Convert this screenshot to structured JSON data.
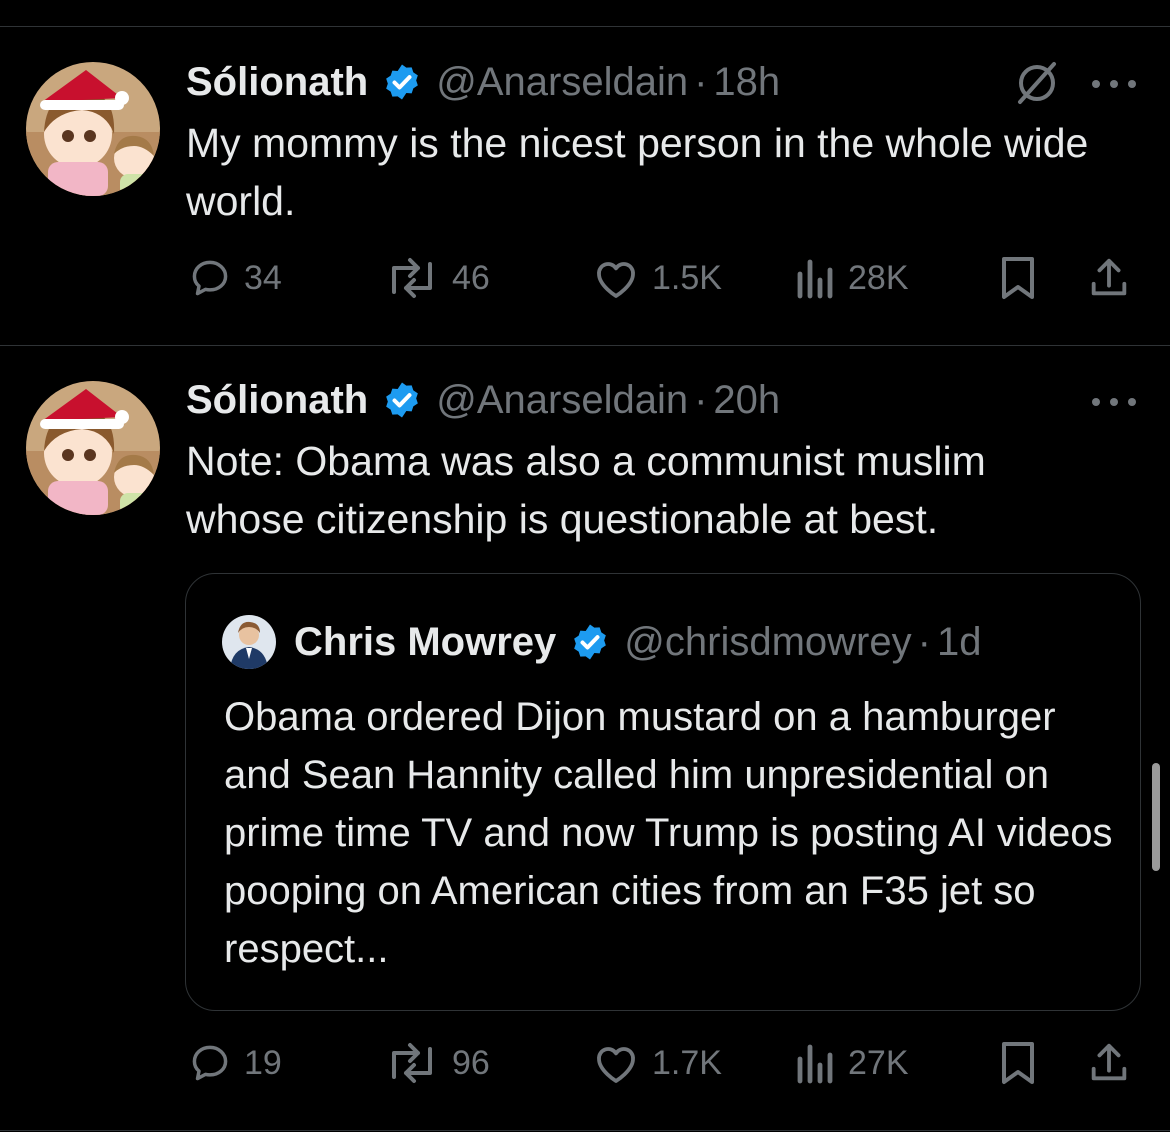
{
  "tweets": [
    {
      "author_name": "Sólionath",
      "handle": "@Anarseldain",
      "time": "18h",
      "text": "My mommy is the nicest person in the whole wide world.",
      "replies": "34",
      "reposts": "46",
      "likes": "1.5K",
      "views": "28K"
    },
    {
      "author_name": "Sólionath",
      "handle": "@Anarseldain",
      "time": "20h",
      "text": "Note: Obama was also a communist muslim whose citizenship is questionable at best.",
      "replies": "19",
      "reposts": "96",
      "likes": "1.7K",
      "views": "27K",
      "quote": {
        "author_name": "Chris Mowrey",
        "handle": "@chrisdmowrey",
        "time": "1d",
        "text": "Obama ordered Dijon mustard on a hamburger and Sean Hannity called him unpresidential on prime time TV and now Trump is posting AI videos pooping on American cities from an F35 jet so respect..."
      }
    }
  ],
  "separator": "·",
  "colors": {
    "background": "#000000",
    "text": "#e7e9ea",
    "muted": "#71767b",
    "verified": "#1d9bf0",
    "divider": "#2f3336"
  },
  "icons": [
    "verified-badge-icon",
    "grok-icon",
    "more-icon",
    "reply-icon",
    "repost-icon",
    "like-icon",
    "views-icon",
    "bookmark-icon",
    "share-icon"
  ]
}
